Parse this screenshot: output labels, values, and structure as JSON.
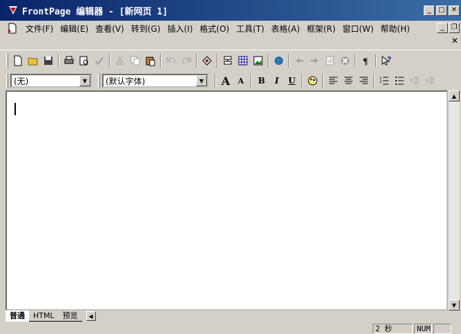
{
  "window": {
    "title": "FrontPage 编辑器 - [新网页 1]"
  },
  "menu": {
    "items": [
      "文件(F)",
      "编辑(E)",
      "查看(V)",
      "转到(G)",
      "插入(I)",
      "格式(O)",
      "工具(T)",
      "表格(A)",
      "框架(R)",
      "窗口(W)",
      "帮助(H)"
    ]
  },
  "format": {
    "style_value": "(无)",
    "font_value": "(默认字体)"
  },
  "tabs": [
    "普通",
    "HTML",
    "预览"
  ],
  "status": {
    "time": "2 秒",
    "num": "NUM"
  },
  "colors": {
    "title_start": "#0a246a",
    "title_end": "#3a6ea5",
    "face": "#d4d0c8"
  }
}
